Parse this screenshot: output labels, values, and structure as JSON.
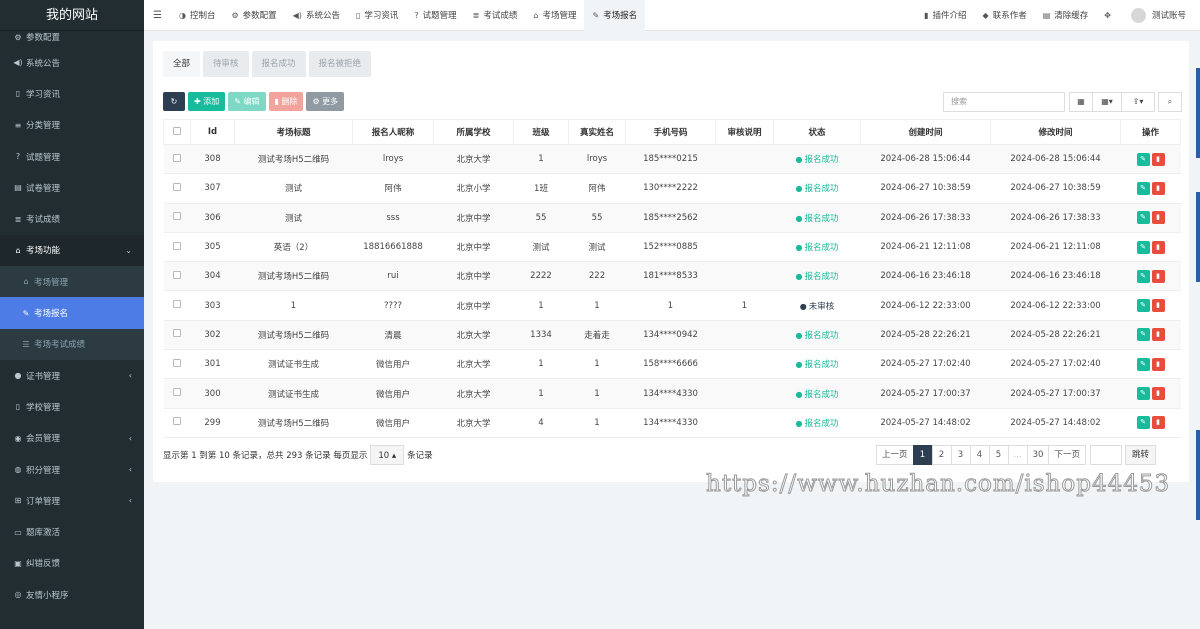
{
  "site_title": "我的网站",
  "sidebar": {
    "items": [
      {
        "label": "参数配置",
        "icon": "gears-icon",
        "glyph": "⚙"
      },
      {
        "label": "系统公告",
        "icon": "volume-icon",
        "glyph": "◀)"
      },
      {
        "label": "学习资讯",
        "icon": "book-icon",
        "glyph": "▯"
      },
      {
        "label": "分类管理",
        "icon": "list-icon",
        "glyph": "≡"
      },
      {
        "label": "试题管理",
        "icon": "question-icon",
        "glyph": "?"
      },
      {
        "label": "试卷管理",
        "icon": "keyboard-icon",
        "glyph": "▤"
      },
      {
        "label": "考试成绩",
        "icon": "list-ul-icon",
        "glyph": "≣"
      },
      {
        "label": "考场功能",
        "icon": "home-icon",
        "glyph": "⌂"
      },
      {
        "label": "考场管理",
        "icon": "home-icon",
        "glyph": "⌂"
      },
      {
        "label": "考场报名",
        "icon": "pencil-icon",
        "glyph": "✎"
      },
      {
        "label": "考场考试成绩",
        "icon": "list-icon",
        "glyph": "☰"
      },
      {
        "label": "证书管理",
        "icon": "circle-icon",
        "glyph": "●"
      },
      {
        "label": "学校管理",
        "icon": "file-icon",
        "glyph": "▯"
      },
      {
        "label": "会员管理",
        "icon": "user-icon",
        "glyph": "◉"
      },
      {
        "label": "积分管理",
        "icon": "coin-icon",
        "glyph": "◍"
      },
      {
        "label": "订单管理",
        "icon": "cart-icon",
        "glyph": "⊞"
      },
      {
        "label": "题库激活",
        "icon": "card-icon",
        "glyph": "▭"
      },
      {
        "label": "纠错反馈",
        "icon": "chat-icon",
        "glyph": "▣"
      },
      {
        "label": "友情小程序",
        "icon": "eye-icon",
        "glyph": "◎"
      }
    ]
  },
  "topnav": {
    "tabs": [
      {
        "label": "控制台",
        "icon": "dashboard-icon",
        "glyph": "◑"
      },
      {
        "label": "参数配置",
        "icon": "gears-icon",
        "glyph": "⚙"
      },
      {
        "label": "系统公告",
        "icon": "volume-icon",
        "glyph": "◀)"
      },
      {
        "label": "学习资讯",
        "icon": "book-icon",
        "glyph": "▯"
      },
      {
        "label": "试题管理",
        "icon": "question-icon",
        "glyph": "?"
      },
      {
        "label": "考试成绩",
        "icon": "list-ul-icon",
        "glyph": "≣"
      },
      {
        "label": "考场管理",
        "icon": "home-icon",
        "glyph": "⌂"
      },
      {
        "label": "考场报名",
        "icon": "pencil-icon",
        "glyph": "✎"
      }
    ],
    "right": {
      "plugin": "插件介绍",
      "contact": "联系作者",
      "clear_cache": "清除缓存",
      "account": "测试账号"
    }
  },
  "filter_tabs": [
    "全部",
    "待审核",
    "报名成功",
    "报名被拒绝"
  ],
  "toolbar": {
    "add": "添加",
    "edit": "编辑",
    "delete": "删除",
    "more": "更多",
    "search_placeholder": "搜索"
  },
  "table": {
    "headers": [
      "Id",
      "考场标题",
      "报名人昵称",
      "所属学校",
      "班级",
      "真实姓名",
      "手机号码",
      "审核说明",
      "状态",
      "创建时间",
      "修改时间",
      "操作"
    ],
    "rows": [
      {
        "id": "308",
        "title": "测试考场H5二维码",
        "nick": "lroys",
        "school": "北京大学",
        "cls": "1",
        "name": "lroys",
        "phone": "185****0215",
        "note": "",
        "status": "报名成功",
        "ok": true,
        "created": "2024-06-28 15:06:44",
        "updated": "2024-06-28 15:06:44"
      },
      {
        "id": "307",
        "title": "测试",
        "nick": "阿伟",
        "school": "北京小学",
        "cls": "1班",
        "name": "阿伟",
        "phone": "130****2222",
        "note": "",
        "status": "报名成功",
        "ok": true,
        "created": "2024-06-27 10:38:59",
        "updated": "2024-06-27 10:38:59"
      },
      {
        "id": "306",
        "title": "测试",
        "nick": "sss",
        "school": "北京中学",
        "cls": "55",
        "name": "55",
        "phone": "185****2562",
        "note": "",
        "status": "报名成功",
        "ok": true,
        "created": "2024-06-26 17:38:33",
        "updated": "2024-06-26 17:38:33"
      },
      {
        "id": "305",
        "title": "英语（2）",
        "nick": "18816661888",
        "school": "北京中学",
        "cls": "测试",
        "name": "测试",
        "phone": "152****0885",
        "note": "",
        "status": "报名成功",
        "ok": true,
        "created": "2024-06-21 12:11:08",
        "updated": "2024-06-21 12:11:08"
      },
      {
        "id": "304",
        "title": "测试考场H5二维码",
        "nick": "rui",
        "school": "北京中学",
        "cls": "2222",
        "name": "222",
        "phone": "181****8533",
        "note": "",
        "status": "报名成功",
        "ok": true,
        "created": "2024-06-16 23:46:18",
        "updated": "2024-06-16 23:46:18"
      },
      {
        "id": "303",
        "title": "1",
        "nick": "????",
        "school": "北京中学",
        "cls": "1",
        "name": "1",
        "phone": "1",
        "note": "1",
        "status": "未审核",
        "ok": false,
        "created": "2024-06-12 22:33:00",
        "updated": "2024-06-12 22:33:00"
      },
      {
        "id": "302",
        "title": "测试考场H5二维码",
        "nick": "清晨",
        "school": "北京大学",
        "cls": "1334",
        "name": "走着走",
        "phone": "134****0942",
        "note": "",
        "status": "报名成功",
        "ok": true,
        "created": "2024-05-28 22:26:21",
        "updated": "2024-05-28 22:26:21"
      },
      {
        "id": "301",
        "title": "测试证书生成",
        "nick": "微信用户",
        "school": "北京大学",
        "cls": "1",
        "name": "1",
        "phone": "158****6666",
        "note": "",
        "status": "报名成功",
        "ok": true,
        "created": "2024-05-27 17:02:40",
        "updated": "2024-05-27 17:02:40"
      },
      {
        "id": "300",
        "title": "测试证书生成",
        "nick": "微信用户",
        "school": "北京大学",
        "cls": "1",
        "name": "1",
        "phone": "134****4330",
        "note": "",
        "status": "报名成功",
        "ok": true,
        "created": "2024-05-27 17:00:37",
        "updated": "2024-05-27 17:00:37"
      },
      {
        "id": "299",
        "title": "测试考场H5二维码",
        "nick": "微信用户",
        "school": "北京大学",
        "cls": "4",
        "name": "1",
        "phone": "134****4330",
        "note": "",
        "status": "报名成功",
        "ok": true,
        "created": "2024-05-27 14:48:02",
        "updated": "2024-05-27 14:48:02"
      }
    ]
  },
  "footer": {
    "info_prefix": "显示第 1 到第 10 条记录，总共 293 条记录 每页显示",
    "page_size": "10",
    "info_suffix": "条记录",
    "prev": "上一页",
    "next": "下一页",
    "pages": [
      "1",
      "2",
      "3",
      "4",
      "5",
      "...",
      "30"
    ],
    "current_page": "1",
    "jump": "跳转"
  },
  "watermark": "https://www.huzhan.com/ishop44453",
  "colors": {
    "primary": "#2c3e50",
    "success": "#18bc9c",
    "danger": "#e74c3c",
    "sidebar": "#222d32",
    "active": "#4e7ce7"
  }
}
